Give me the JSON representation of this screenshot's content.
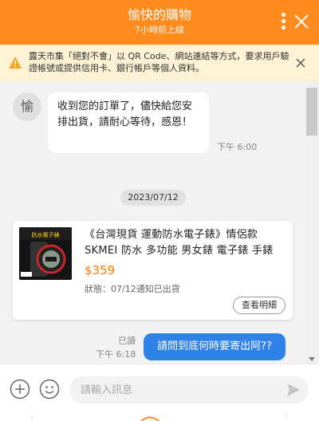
{
  "header": {
    "title": "愉快的購物",
    "subtitle": "7小時前上線"
  },
  "warning": {
    "text": "露天市集「絕對不會」以 QR Code、網站連結等方式，要求用戶驗證帳號或提供信用卡、銀行帳戶等個人資料。"
  },
  "chat": {
    "avatar_text": "愉",
    "incoming": {
      "text": "收到您的訂單了，儘快給您安排出貨，請耐心等待，感恩！",
      "time": "下午 6:00"
    },
    "date_divider": "2023/07/12",
    "order_card": {
      "product_name": "《台灣現貨 運動防水電子錶》情侶款 SKMEI 防水 多功能 男女錶 電子錶 手錶",
      "price": "$359",
      "status": "狀態：07/12通知已出貨",
      "detail_button": "查看明細",
      "thumb_label": "防水電子錶"
    },
    "outgoing": {
      "text": "請問到底何時要寄出阿??",
      "read_label": "已讀",
      "time": "下午 6:18"
    }
  },
  "input": {
    "placeholder": "請輸入訊息"
  },
  "colors": {
    "brand": "#ff8a1e",
    "outgoing_bubble": "#2e82e8",
    "price": "#ff7a00",
    "warning_bg": "#fff3d6"
  }
}
